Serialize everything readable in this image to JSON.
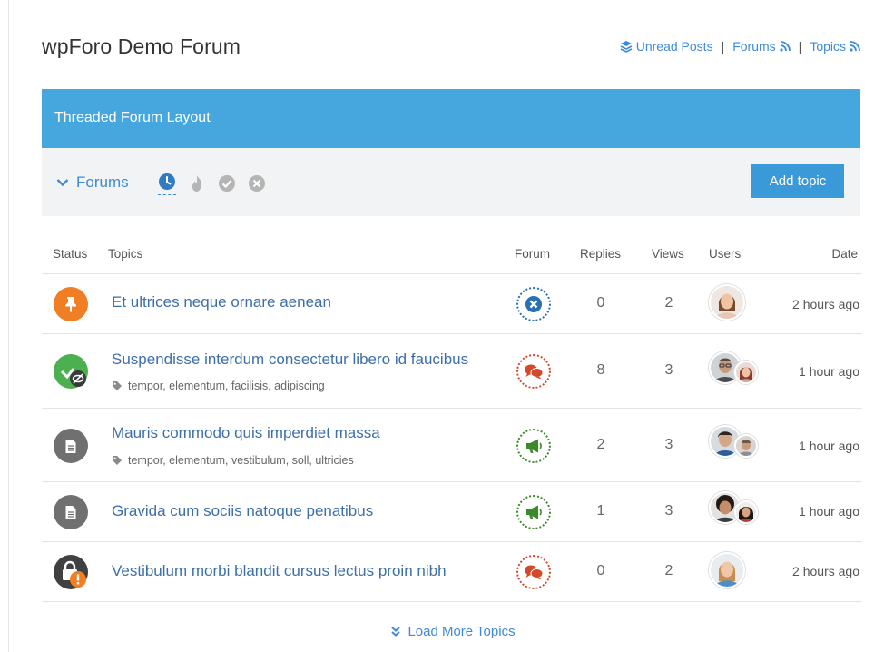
{
  "header": {
    "site_title": "wpForo Demo Forum",
    "links": {
      "unread": "Unread Posts",
      "forums": "Forums",
      "topics": "Topics",
      "separator": "|"
    }
  },
  "banner": {
    "title": "Threaded Forum Layout"
  },
  "toolbar": {
    "forums_label": "Forums",
    "filters": [
      "clock-icon",
      "flame-icon",
      "check-circle-icon",
      "x-circle-icon"
    ],
    "add_topic": "Add topic"
  },
  "table": {
    "headers": {
      "status": "Status",
      "topics": "Topics",
      "forum": "Forum",
      "replies": "Replies",
      "views": "Views",
      "users": "Users",
      "date": "Date"
    },
    "rows": [
      {
        "status_icon": "pin-icon",
        "status_color": "#f07e24",
        "title": "Et ultrices neque ornare aenean",
        "tags": "",
        "forum_icon": "x-circle-icon",
        "forum_color": "#2a6fb5",
        "replies": "0",
        "views": "2",
        "date": "2 hours ago"
      },
      {
        "status_icon": "check-hidden-icon",
        "status_color": "#4caf50",
        "title": "Suspendisse interdum consectetur libero id faucibus",
        "tags": "tempor, elementum, facilisis, adipiscing",
        "forum_icon": "comments-icon",
        "forum_color": "#d24a2a",
        "replies": "8",
        "views": "3",
        "date": "1 hour ago"
      },
      {
        "status_icon": "document-icon",
        "status_color": "#707070",
        "title": "Mauris commodo quis imperdiet massa",
        "tags": "tempor, elementum, vestibulum, soll, ultricies",
        "forum_icon": "megaphone-icon",
        "forum_color": "#3b8a2b",
        "replies": "2",
        "views": "3",
        "date": "1 hour ago"
      },
      {
        "status_icon": "document-icon",
        "status_color": "#707070",
        "title": "Gravida cum sociis natoque penatibus",
        "tags": "",
        "forum_icon": "megaphone-icon",
        "forum_color": "#3b8a2b",
        "replies": "1",
        "views": "3",
        "date": "1 hour ago"
      },
      {
        "status_icon": "lock-alert-icon",
        "status_color": "#404040",
        "title": "Vestibulum morbi blandit cursus lectus proin nibh",
        "tags": "",
        "forum_icon": "comments-icon",
        "forum_color": "#d24a2a",
        "replies": "0",
        "views": "2",
        "date": "2 hours ago"
      }
    ]
  },
  "load_more": "Load More Topics",
  "colors": {
    "accent": "#46a7df",
    "link": "#3d8bd8",
    "button": "#3a9ad9"
  }
}
